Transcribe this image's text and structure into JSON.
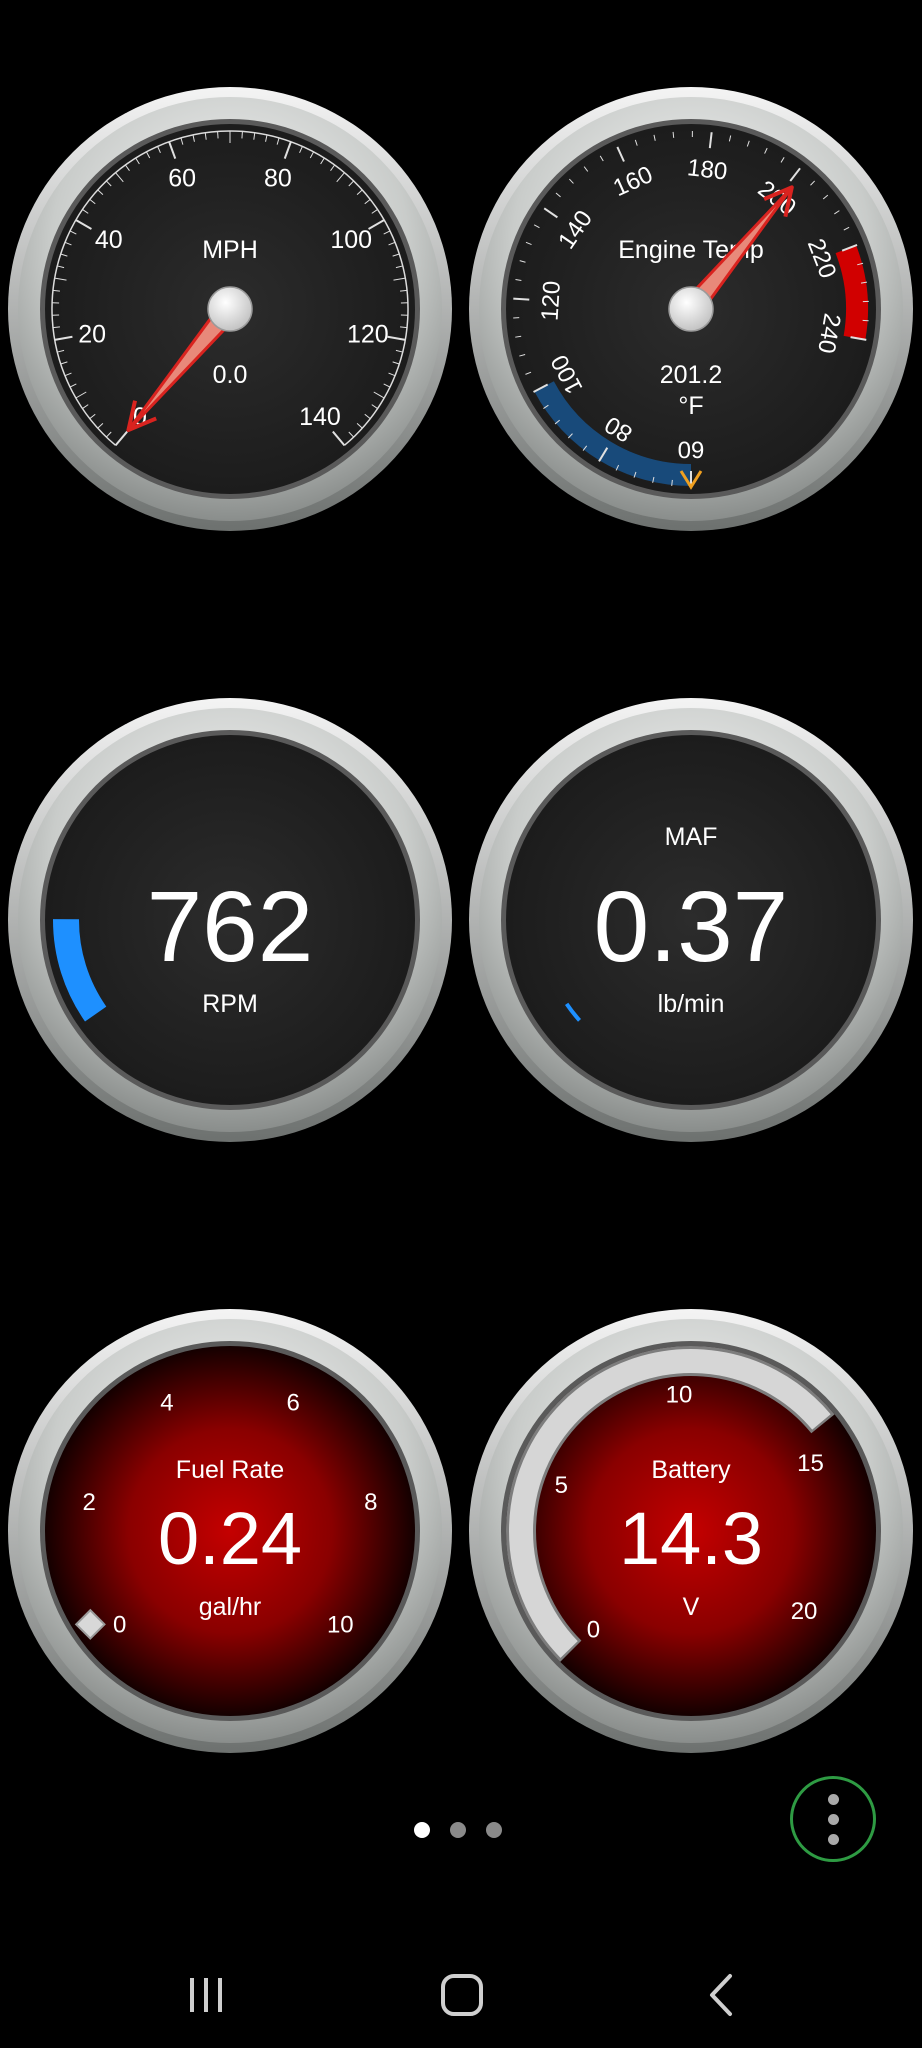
{
  "gauges": {
    "speed": {
      "title": "MPH",
      "value": "0.0",
      "value_num": 0,
      "range": [
        0,
        140
      ],
      "ticks": [
        "0",
        "20",
        "40",
        "60",
        "80",
        "100",
        "120",
        "140"
      ]
    },
    "engine_temp": {
      "title": "Engine Temp",
      "value": "201.2",
      "unit": "°F",
      "value_num": 201.2,
      "range": [
        60,
        240
      ],
      "ticks": [
        "60",
        "80",
        "100",
        "120",
        "140",
        "160",
        "180",
        "200",
        "220",
        "240"
      ],
      "cold_band": [
        60,
        100
      ],
      "hot_band": [
        220,
        240
      ],
      "min_marker": 60
    },
    "rpm": {
      "value": "762",
      "unit": "RPM",
      "fraction": 0.12
    },
    "maf": {
      "title": "MAF",
      "value": "0.37",
      "unit": "lb/min",
      "fraction": 0.02
    },
    "fuel_rate": {
      "title": "Fuel Rate",
      "value": "0.24",
      "unit": "gal/hr",
      "value_num": 0.24,
      "range": [
        0,
        10
      ],
      "ticks": [
        "0",
        "2",
        "4",
        "6",
        "8",
        "10"
      ]
    },
    "battery": {
      "title": "Battery",
      "value": "14.3",
      "unit": "V",
      "value_num": 14.3,
      "range": [
        0,
        20
      ],
      "ticks": [
        "0",
        "5",
        "10",
        "15",
        "20"
      ]
    }
  },
  "pager": {
    "pages": 3,
    "active": 0
  },
  "menu_button": {
    "icon": "more-vert-icon",
    "ring_color": "#2e9b43"
  },
  "navbar": {
    "recents_icon": "recents-icon",
    "home_icon": "home-icon",
    "back_icon": "back-icon"
  },
  "colors": {
    "needle": "#d9231f",
    "arc_blue": "#1e90ff",
    "cold_band": "#184a7a",
    "hot_band": "#d10000",
    "min_marker": "#f0a020"
  }
}
